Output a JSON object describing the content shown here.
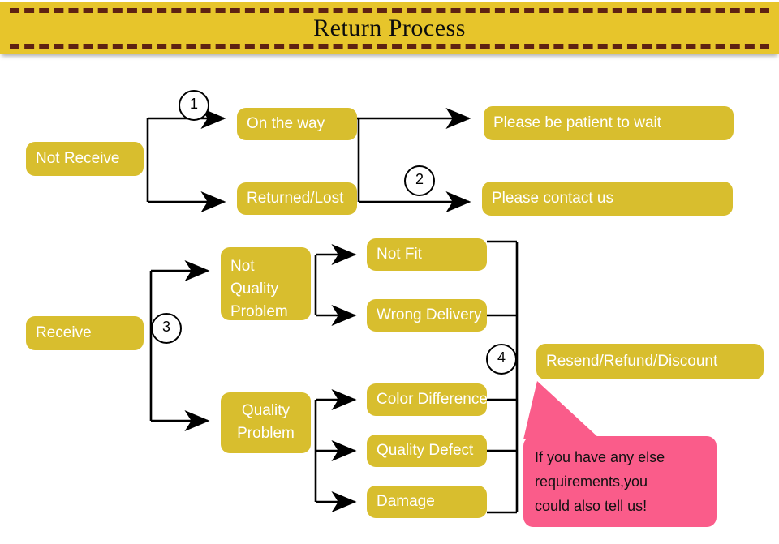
{
  "header": {
    "title": "Return Process"
  },
  "colors": {
    "banner": "#E7C52B",
    "stitch": "#5E2212",
    "node": "#D8BE2E",
    "node_text": "#FFFFFF",
    "callout": "#FA5C8A",
    "wire": "#000000",
    "background": "#FFFFFF"
  },
  "flow": {
    "branch_not_receive": {
      "root": "Not Receive",
      "marker_1": "1",
      "marker_2": "2",
      "stage1": [
        "On the way",
        "Returned/Lost"
      ],
      "stage2": [
        "Please be patient to wait",
        "Please contact us"
      ]
    },
    "branch_receive": {
      "root": "Receive",
      "marker_3": "3",
      "marker_4": "4",
      "categories": [
        "Not Quality Problem",
        "Quality Problem"
      ],
      "not_quality_reasons": [
        "Not Fit",
        "Wrong Delivery"
      ],
      "quality_reasons": [
        "Color Difference",
        "Quality Defect",
        "Damage"
      ],
      "outcome": "Resend/Refund/Discount"
    }
  },
  "callout": {
    "line1": "If you have any else",
    "line2": "requirements,you",
    "line3": "could also tell us!"
  }
}
